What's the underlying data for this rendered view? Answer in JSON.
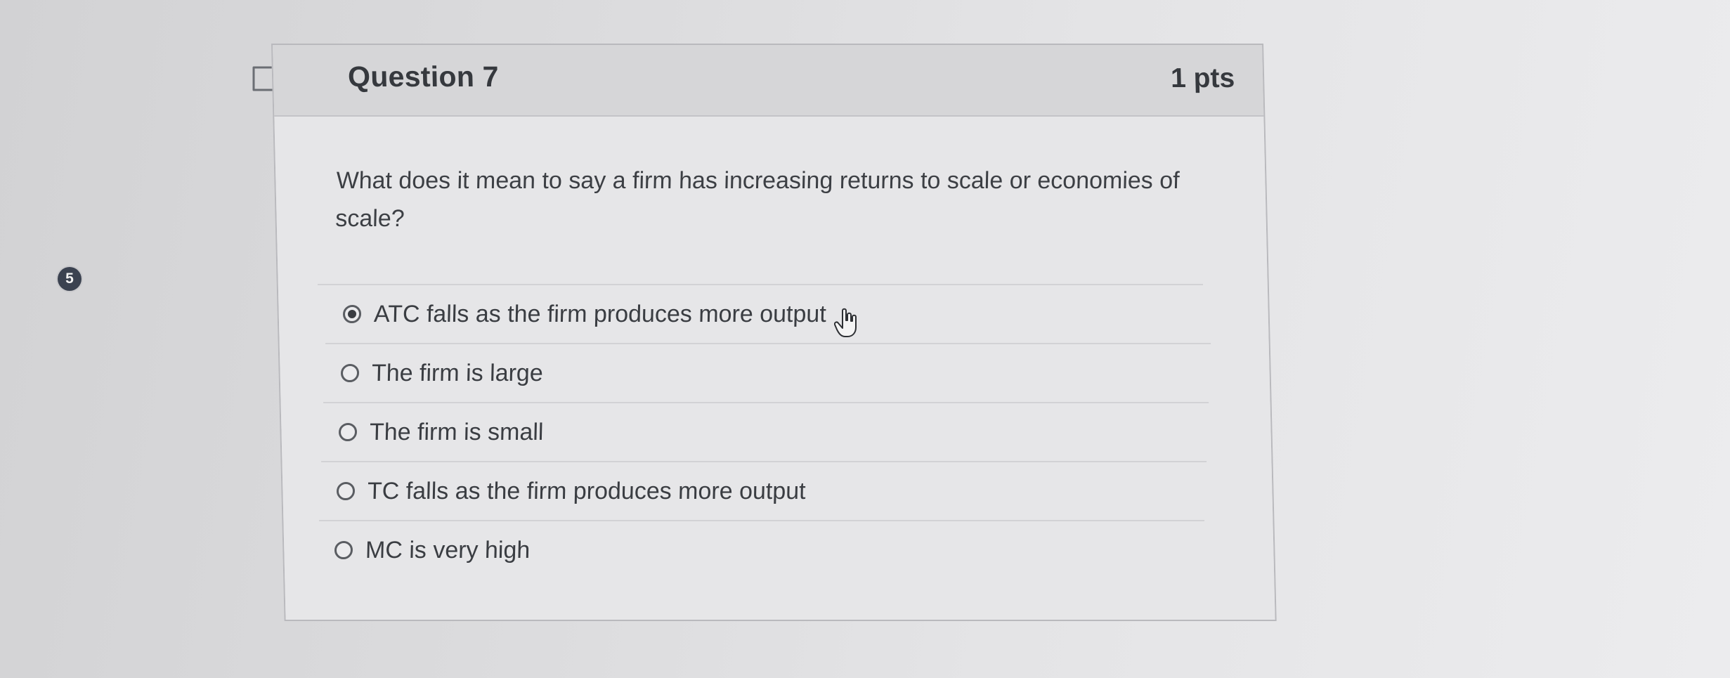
{
  "nav": {
    "badge": "5"
  },
  "question": {
    "title": "Question 7",
    "points": "1 pts",
    "text": "What does it mean to say a firm has increasing returns to scale or economies of scale?"
  },
  "answers": [
    {
      "label": "ATC falls as the firm produces more output",
      "selected": true
    },
    {
      "label": "The firm is large",
      "selected": false
    },
    {
      "label": "The firm is small",
      "selected": false
    },
    {
      "label": "TC falls as the firm produces more output",
      "selected": false
    },
    {
      "label": "MC is very high",
      "selected": false
    }
  ],
  "icons": {
    "flag": "flag-icon",
    "cursor": "hand-cursor-icon"
  },
  "colors": {
    "selected_radio": "#3a3d42",
    "badge_bg": "#3b4250"
  }
}
